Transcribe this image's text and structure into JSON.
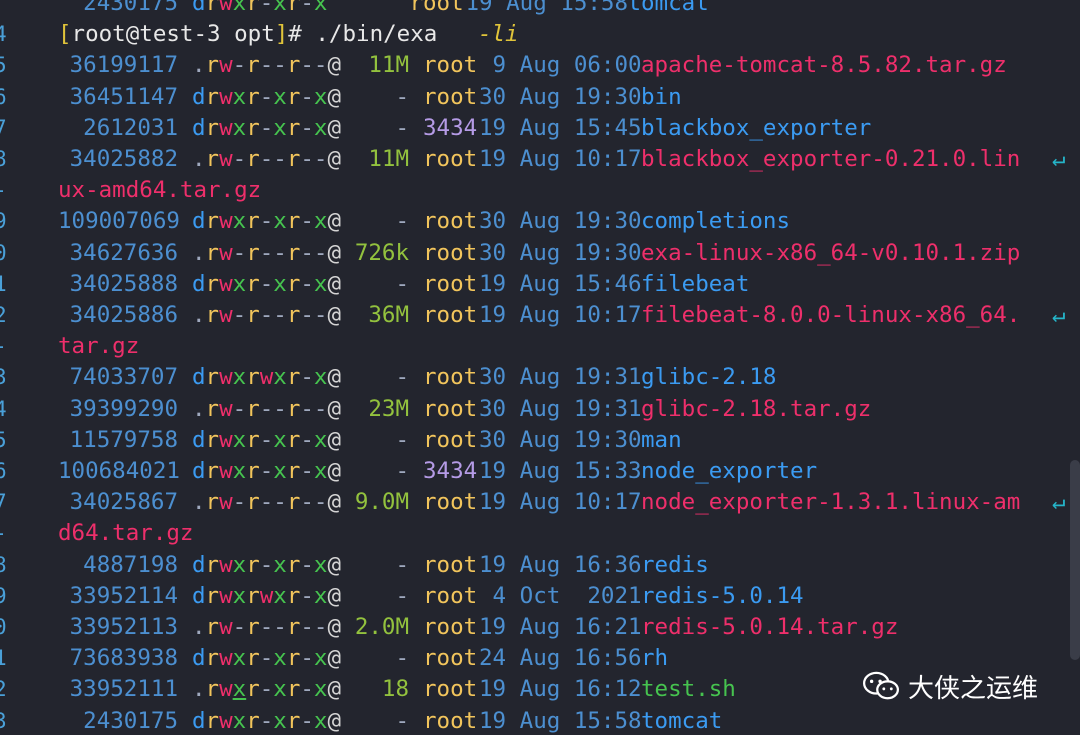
{
  "gutter": [
    "4",
    "5",
    "6",
    "7",
    "8",
    "-",
    "9",
    "0",
    "1",
    "2",
    "-",
    "3",
    "4",
    "5",
    "6",
    "7",
    "-",
    "8",
    "9",
    "0",
    "1",
    "2",
    "3"
  ],
  "partial_top": {
    "inode": "2430175",
    "perm": "drwxr-xr-x",
    "user": "root",
    "date": "19 Aug 15:58",
    "name": "tomcat"
  },
  "prompt": {
    "open": "[",
    "user_host": "root@test-3",
    "dir": "opt",
    "close": "]",
    "symbol": "#",
    "command": "./bin/exa",
    "flag": "-li"
  },
  "rows": [
    {
      "inode": "36199117",
      "perm": ".rw-r--r--@",
      "size": "11M",
      "size_kind": "num",
      "user": "root",
      "date": " 9 Aug 06:00",
      "name": "apache-tomcat-8.5.82.tar.gz",
      "kind": "arc"
    },
    {
      "inode": "36451147",
      "perm": "drwxr-xr-x@",
      "size": "-",
      "size_kind": "none",
      "user": "root",
      "date": "30 Aug 19:30",
      "name": "bin",
      "kind": "dir"
    },
    {
      "inode": "2612031",
      "perm": "drwxr-xr-x@",
      "size": "-",
      "size_kind": "none",
      "user": "3434",
      "user_kind": "uid",
      "date": "19 Aug 15:45",
      "name": "blackbox_exporter",
      "kind": "dir"
    },
    {
      "inode": "34025882",
      "perm": ".rw-r--r--@",
      "size": "11M",
      "size_kind": "num",
      "user": "root",
      "date": "19 Aug 10:17",
      "name": "blackbox_exporter-0.21.0.lin",
      "kind": "arc",
      "wrap": "ux-amd64.tar.gz"
    },
    {
      "inode": "109007069",
      "perm": "drwxr-xr-x@",
      "size": "-",
      "size_kind": "none",
      "user": "root",
      "date": "30 Aug 19:30",
      "name": "completions",
      "kind": "dir"
    },
    {
      "inode": "34627636",
      "perm": ".rw-r--r--@",
      "size": "726k",
      "size_kind": "num",
      "user": "root",
      "date": "30 Aug 19:30",
      "name": "exa-linux-x86_64-v0.10.1.zip",
      "kind": "arc"
    },
    {
      "inode": "34025888",
      "perm": "drwxr-xr-x@",
      "size": "-",
      "size_kind": "none",
      "user": "root",
      "date": "19 Aug 15:46",
      "name": "filebeat",
      "kind": "dir"
    },
    {
      "inode": "34025886",
      "perm": ".rw-r--r--@",
      "size": "36M",
      "size_kind": "num",
      "user": "root",
      "date": "19 Aug 10:17",
      "name": "filebeat-8.0.0-linux-x86_64.",
      "kind": "arc",
      "wrap": "tar.gz"
    },
    {
      "inode": "74033707",
      "perm": "drwxrwxr-x@",
      "size": "-",
      "size_kind": "none",
      "user": "root",
      "date": "30 Aug 19:31",
      "name": "glibc-2.18",
      "kind": "dir"
    },
    {
      "inode": "39399290",
      "perm": ".rw-r--r--@",
      "size": "23M",
      "size_kind": "num",
      "user": "root",
      "date": "30 Aug 19:31",
      "name": "glibc-2.18.tar.gz",
      "kind": "arc"
    },
    {
      "inode": "11579758",
      "perm": "drwxr-xr-x@",
      "size": "-",
      "size_kind": "none",
      "user": "root",
      "date": "30 Aug 19:30",
      "name": "man",
      "kind": "dir"
    },
    {
      "inode": "100684021",
      "perm": "drwxr-xr-x@",
      "size": "-",
      "size_kind": "none",
      "user": "3434",
      "user_kind": "uid",
      "date": "19 Aug 15:33",
      "name": "node_exporter",
      "kind": "dir"
    },
    {
      "inode": "34025867",
      "perm": ".rw-r--r--@",
      "size": "9.0M",
      "size_kind": "num",
      "user": "root",
      "date": "19 Aug 10:17",
      "name": "node_exporter-1.3.1.linux-am",
      "kind": "arc",
      "wrap": "d64.tar.gz"
    },
    {
      "inode": "4887198",
      "perm": "drwxr-xr-x@",
      "size": "-",
      "size_kind": "none",
      "user": "root",
      "date": "19 Aug 16:36",
      "name": "redis",
      "kind": "dir"
    },
    {
      "inode": "33952114",
      "perm": "drwxrwxr-x@",
      "size": "-",
      "size_kind": "none",
      "user": "root",
      "date": " 4 Oct  2021",
      "name": "redis-5.0.14",
      "kind": "dir"
    },
    {
      "inode": "33952113",
      "perm": ".rw-r--r--@",
      "size": "2.0M",
      "size_kind": "num",
      "user": "root",
      "date": "19 Aug 16:21",
      "name": "redis-5.0.14.tar.gz",
      "kind": "arc"
    },
    {
      "inode": "73683938",
      "perm": "drwxr-xr-x@",
      "size": "-",
      "size_kind": "none",
      "user": "root",
      "date": "24 Aug 16:56",
      "name": "rh",
      "kind": "dir"
    },
    {
      "inode": "33952111",
      "perm": ".rwxr-xr-x@",
      "size": "18",
      "size_kind": "num",
      "user": "root",
      "date": "19 Aug 16:12",
      "name": "test.sh",
      "kind": "exec",
      "owner_x_underline": true
    },
    {
      "inode": "2430175",
      "perm": "drwxr-xr-x@",
      "size": "-",
      "size_kind": "none",
      "user": "root",
      "date": "19 Aug 15:58",
      "name": "tomcat",
      "kind": "dir"
    }
  ],
  "wrap_marker": "↵",
  "watermark": {
    "icon": "wechat-icon",
    "text": "大侠之运维"
  },
  "colors": {
    "background": "#23252e",
    "directory": "#3b9bf2",
    "archive": "#ee2f6b",
    "executable": "#46c34f",
    "inode": "#4c8fd0",
    "user": "#f2c55c"
  }
}
